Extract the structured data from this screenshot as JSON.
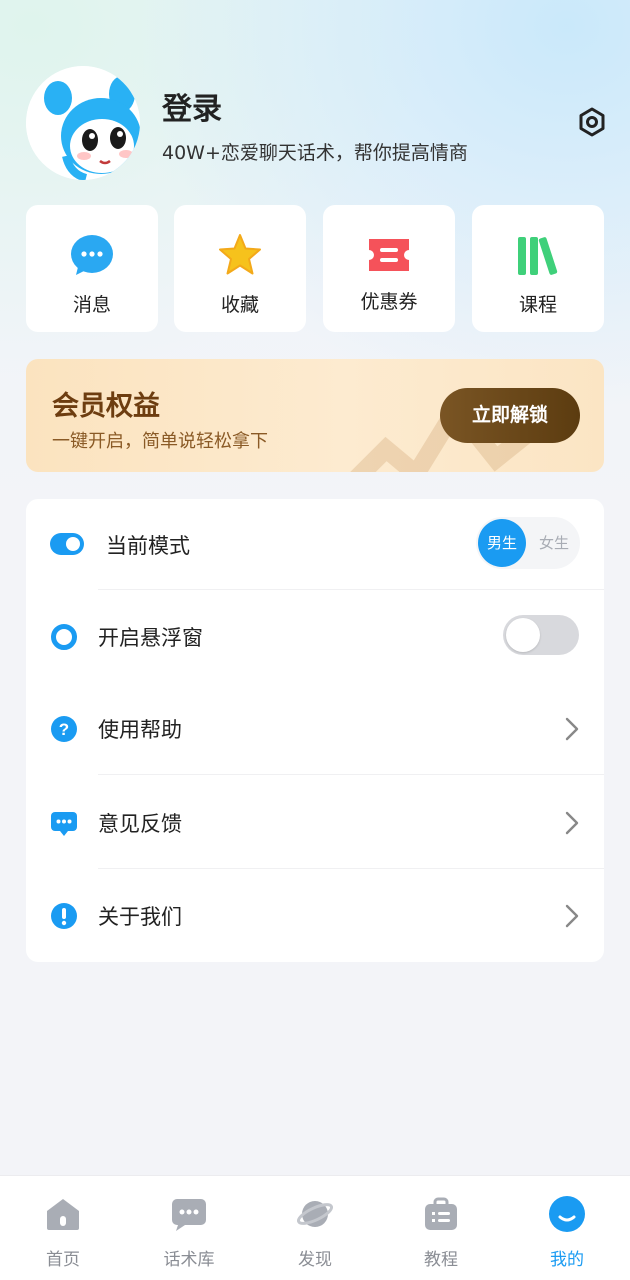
{
  "header": {
    "login_title": "登录",
    "login_subtitle": "40W+恋爱聊天话术，帮你提高情商",
    "settings_icon": "settings-hex-icon"
  },
  "quick_actions": [
    {
      "label": "消息",
      "icon": "chat-bubble-icon",
      "color": "#2aa8f2"
    },
    {
      "label": "收藏",
      "icon": "star-icon",
      "color": "#f6c21c"
    },
    {
      "label": "优惠券",
      "icon": "coupon-icon",
      "color": "#f5525a"
    },
    {
      "label": "课程",
      "icon": "books-icon",
      "color": "#3fd07a"
    }
  ],
  "vip": {
    "title": "会员权益",
    "subtitle": "一键开启，简单说轻松拿下",
    "button": "立即解锁"
  },
  "menu": {
    "mode": {
      "label": "当前模式",
      "male": "男生",
      "female": "女生",
      "selected": "男生"
    },
    "float": {
      "label": "开启悬浮窗",
      "enabled": false
    },
    "help": {
      "label": "使用帮助"
    },
    "feedback": {
      "label": "意见反馈"
    },
    "about": {
      "label": "关于我们"
    }
  },
  "tabbar": {
    "items": [
      {
        "label": "首页",
        "icon": "home-icon"
      },
      {
        "label": "话术库",
        "icon": "message-library-icon"
      },
      {
        "label": "发现",
        "icon": "planet-icon"
      },
      {
        "label": "教程",
        "icon": "tutorial-icon"
      },
      {
        "label": "我的",
        "icon": "profile-icon"
      }
    ],
    "active": "我的"
  },
  "colors": {
    "accent": "#1a9bf2",
    "vip_text": "#6d3d10",
    "vip_button": "#6b4a1c"
  }
}
